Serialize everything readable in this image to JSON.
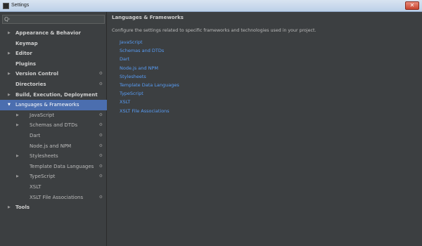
{
  "window": {
    "title": "Settings",
    "close_glyph": "✕"
  },
  "search": {
    "icon": "Q·"
  },
  "tree": [
    {
      "label": "Appearance & Behavior",
      "level": 0,
      "bold": true,
      "expandable": true,
      "selected": false,
      "gear": false
    },
    {
      "label": "Keymap",
      "level": 0,
      "bold": true,
      "expandable": false,
      "selected": false,
      "gear": false
    },
    {
      "label": "Editor",
      "level": 0,
      "bold": true,
      "expandable": true,
      "selected": false,
      "gear": false
    },
    {
      "label": "Plugins",
      "level": 0,
      "bold": true,
      "expandable": false,
      "selected": false,
      "gear": false
    },
    {
      "label": "Version Control",
      "level": 0,
      "bold": true,
      "expandable": true,
      "selected": false,
      "gear": true
    },
    {
      "label": "Directories",
      "level": 0,
      "bold": true,
      "expandable": false,
      "selected": false,
      "gear": true
    },
    {
      "label": "Build, Execution, Deployment",
      "level": 0,
      "bold": true,
      "expandable": true,
      "selected": false,
      "gear": false
    },
    {
      "label": "Languages & Frameworks",
      "level": 0,
      "bold": false,
      "expandable": true,
      "expanded": true,
      "selected": true,
      "gear": false
    },
    {
      "label": "JavaScript",
      "level": 1,
      "bold": false,
      "expandable": true,
      "selected": false,
      "gear": true
    },
    {
      "label": "Schemas and DTDs",
      "level": 1,
      "bold": false,
      "expandable": true,
      "selected": false,
      "gear": true
    },
    {
      "label": "Dart",
      "level": 1,
      "bold": false,
      "expandable": false,
      "selected": false,
      "gear": true
    },
    {
      "label": "Node.js and NPM",
      "level": 1,
      "bold": false,
      "expandable": false,
      "selected": false,
      "gear": true
    },
    {
      "label": "Stylesheets",
      "level": 1,
      "bold": false,
      "expandable": true,
      "selected": false,
      "gear": true
    },
    {
      "label": "Template Data Languages",
      "level": 1,
      "bold": false,
      "expandable": false,
      "selected": false,
      "gear": true
    },
    {
      "label": "TypeScript",
      "level": 1,
      "bold": false,
      "expandable": true,
      "selected": false,
      "gear": true
    },
    {
      "label": "XSLT",
      "level": 1,
      "bold": false,
      "expandable": false,
      "selected": false,
      "gear": false
    },
    {
      "label": "XSLT File Associations",
      "level": 1,
      "bold": false,
      "expandable": false,
      "selected": false,
      "gear": true
    },
    {
      "label": "Tools",
      "level": 0,
      "bold": true,
      "expandable": true,
      "selected": false,
      "gear": false
    }
  ],
  "content": {
    "heading": "Languages & Frameworks",
    "description": "Configure the settings related to specific frameworks and technologies used in your project.",
    "links": [
      "JavaScript",
      "Schemas and DTDs",
      "Dart",
      "Node.js and NPM",
      "Stylesheets",
      "Template Data Languages",
      "TypeScript",
      "XSLT",
      "XSLT File Associations"
    ]
  },
  "colors": {
    "background": "#3c3f41",
    "selection": "#4b6eaf",
    "link": "#589df6",
    "text": "#bbbbbb"
  },
  "icons": {
    "collapsed_arrow": "▶",
    "expanded_arrow": "▼",
    "gear": "⚙"
  }
}
